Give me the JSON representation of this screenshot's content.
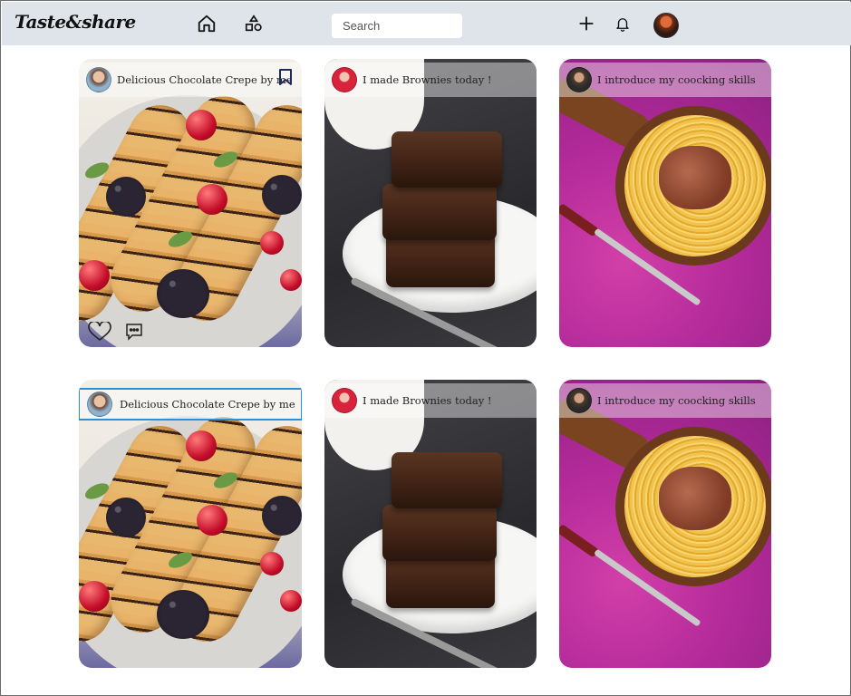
{
  "app": {
    "logo": "Taste&share"
  },
  "header": {
    "search_placeholder": "Search",
    "icons": {
      "home": "home-icon",
      "categories": "shapes-icon",
      "add": "plus-icon",
      "notifications": "bell-icon",
      "profile": "avatar"
    }
  },
  "posts": [
    {
      "title": "Delicious Chocolate Crepe by me",
      "image": "crepe",
      "bookmark": true,
      "actions": true
    },
    {
      "title": "I made Brownies today !",
      "image": "brownie"
    },
    {
      "title": "I introduce my coocking skills",
      "image": "pasta"
    },
    {
      "title": "Delicious Chocolate Crepe by me",
      "image": "crepe",
      "focused": true
    },
    {
      "title": "I made Brownies today !",
      "image": "brownie"
    },
    {
      "title": "I introduce my coocking skills",
      "image": "pasta"
    }
  ],
  "colors": {
    "header_bg": "#dfe4ea",
    "focus_outline": "#2b8fd6",
    "bookmark": "#1f2a5a"
  }
}
